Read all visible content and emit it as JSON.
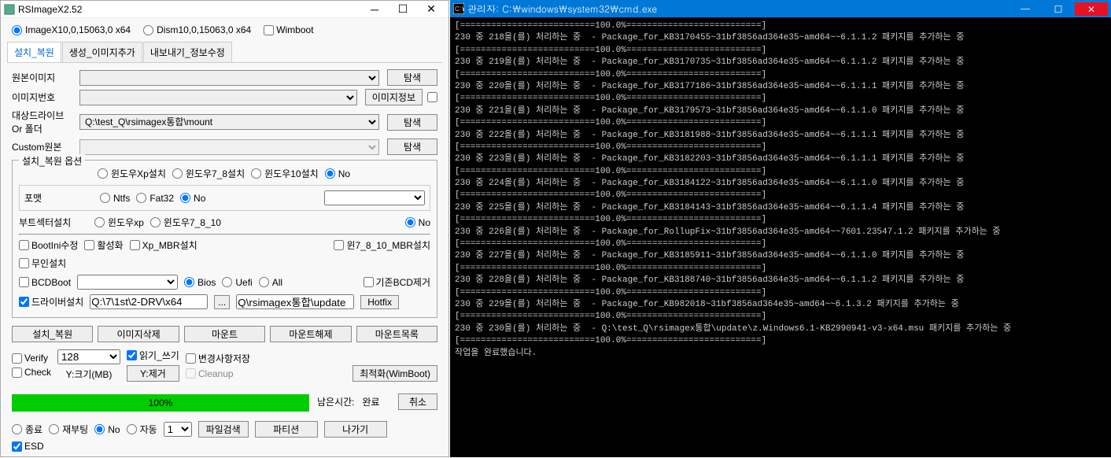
{
  "rsimgx": {
    "title": "RSImageX2.52",
    "top_radios": {
      "imagex": "ImageX10,0,15063,0 x64",
      "dism": "Dism10,0,15063,0 x64"
    },
    "top_radios_selected": "imagex",
    "wimboot": "Wimboot",
    "tabs": [
      "설치_복원",
      "생성_이미지추가",
      "내보내기_정보수정"
    ],
    "active_tab": 0,
    "labels": {
      "source": "원본이미지",
      "imgno": "이미지번호",
      "target": "대상드라이브\nOr 폴더",
      "custom": "Custom원본",
      "browse": "탐색",
      "imginfo": "이미지정보"
    },
    "target_value": "Q:\\test_Q\\rsimagex통합\\mount",
    "group_legend": "설치_복원 옵션",
    "os_radios": [
      "윈도우Xp설치",
      "윈도우7_8설치",
      "윈도우10설치",
      "No"
    ],
    "os_selected": "No",
    "format_label": "포맷",
    "format_radios": [
      "Ntfs",
      "Fat32",
      "No"
    ],
    "format_selected": "No",
    "boot_label": "부트섹터설치",
    "boot_radios": [
      "윈도우xp",
      "윈도우7_8_10",
      "No"
    ],
    "boot_selected": "No",
    "checks": {
      "bootini": "BootIni수정",
      "activate": "활성화",
      "xpmbr": "Xp_MBR설치",
      "win78mbr": "윈7_8_10_MBR설치",
      "noman": "무인설치",
      "bcdboot": "BCDBoot",
      "delbcd": "기존BCD제거",
      "driver": "드라이버설치"
    },
    "bcd_radios": [
      "Bios",
      "Uefi",
      "All"
    ],
    "bcd_selected": "Bios",
    "driver_path": "Q:\\7\\1st\\2-DRV\\x64",
    "update_path": "Q\\rsimagex통합\\update",
    "hotfix": "Hotfix",
    "actions": [
      "설치_복원",
      "이미지삭제",
      "마운트",
      "마운트해제",
      "마운트목록"
    ],
    "verify": "Verify",
    "check": "Check",
    "size_val": "128",
    "size_label": "Y:크기(MB)",
    "rw": "읽기_쓰기",
    "savechg": "변경사항저장",
    "ydel": "Y:제거",
    "cleanup": "Cleanup",
    "optimize": "최적화(WimBoot)",
    "progress": "100%",
    "elapsed_label": "남은시간:",
    "elapsed_val": "완료",
    "cancel": "취소",
    "shutdown_radios": [
      "종료",
      "재부팅",
      "No",
      "자동"
    ],
    "shutdown_selected": "No",
    "shutdown_val": "1",
    "filesearch": "파일검색",
    "partition": "파티션",
    "exit": "나가기",
    "esd": "ESD"
  },
  "cmd": {
    "title": "관리자: C:\\windows\\system32\\cmd.exe",
    "lines": [
      "[==========================100.0%==========================]",
      "230 중 218을(를) 처리하는 중  - Package_for_KB3170455~31bf3856ad364e35~amd64~~6.1.1.2 패키지를 추가하는 중",
      "[==========================100.0%==========================]",
      "230 중 219을(를) 처리하는 중  - Package_for_KB3170735~31bf3856ad364e35~amd64~~6.1.1.2 패키지를 추가하는 중",
      "[==========================100.0%==========================]",
      "230 중 220을(를) 처리하는 중  - Package_for_KB3177186~31bf3856ad364e35~amd64~~6.1.1.1 패키지를 추가하는 중",
      "[==========================100.0%==========================]",
      "230 중 221을(를) 처리하는 중  - Package_for_KB3179573~31bf3856ad364e35~amd64~~6.1.1.0 패키지를 추가하는 중",
      "[==========================100.0%==========================]",
      "230 중 222을(를) 처리하는 중  - Package_for_KB3181988~31bf3856ad364e35~amd64~~6.1.1.1 패키지를 추가하는 중",
      "[==========================100.0%==========================]",
      "230 중 223을(를) 처리하는 중  - Package_for_KB3182203~31bf3856ad364e35~amd64~~6.1.1.1 패키지를 추가하는 중",
      "[==========================100.0%==========================]",
      "230 중 224을(를) 처리하는 중  - Package_for_KB3184122~31bf3856ad364e35~amd64~~6.1.1.0 패키지를 추가하는 중",
      "[==========================100.0%==========================]",
      "230 중 225을(를) 처리하는 중  - Package_for_KB3184143~31bf3856ad364e35~amd64~~6.1.1.4 패키지를 추가하는 중",
      "[==========================100.0%==========================]",
      "230 중 226을(를) 처리하는 중  - Package_for_RollupFix~31bf3856ad364e35~amd64~~7601.23547.1.2 패키지를 추가하는 중",
      "[==========================100.0%==========================]",
      "230 중 227을(를) 처리하는 중  - Package_for_KB3185911~31bf3856ad364e35~amd64~~6.1.1.0 패키지를 추가하는 중",
      "[==========================100.0%==========================]",
      "230 중 228을(를) 처리하는 중  - Package_for_KB3188740~31bf3856ad364e35~amd64~~6.1.1.2 패키지를 추가하는 중",
      "[==========================100.0%==========================]",
      "230 중 229을(를) 처리하는 중  - Package_for_KB982018~31bf3856ad364e35~amd64~~6.1.3.2 패키지를 추가하는 중",
      "[==========================100.0%==========================]",
      "230 중 230을(를) 처리하는 중  - Q:\\test_Q\\rsimagex통합\\update\\z.Windows6.1-KB2990941-v3-x64.msu 패키지를 추가하는 중",
      "[==========================100.0%==========================]",
      "작업을 완료했습니다."
    ]
  }
}
